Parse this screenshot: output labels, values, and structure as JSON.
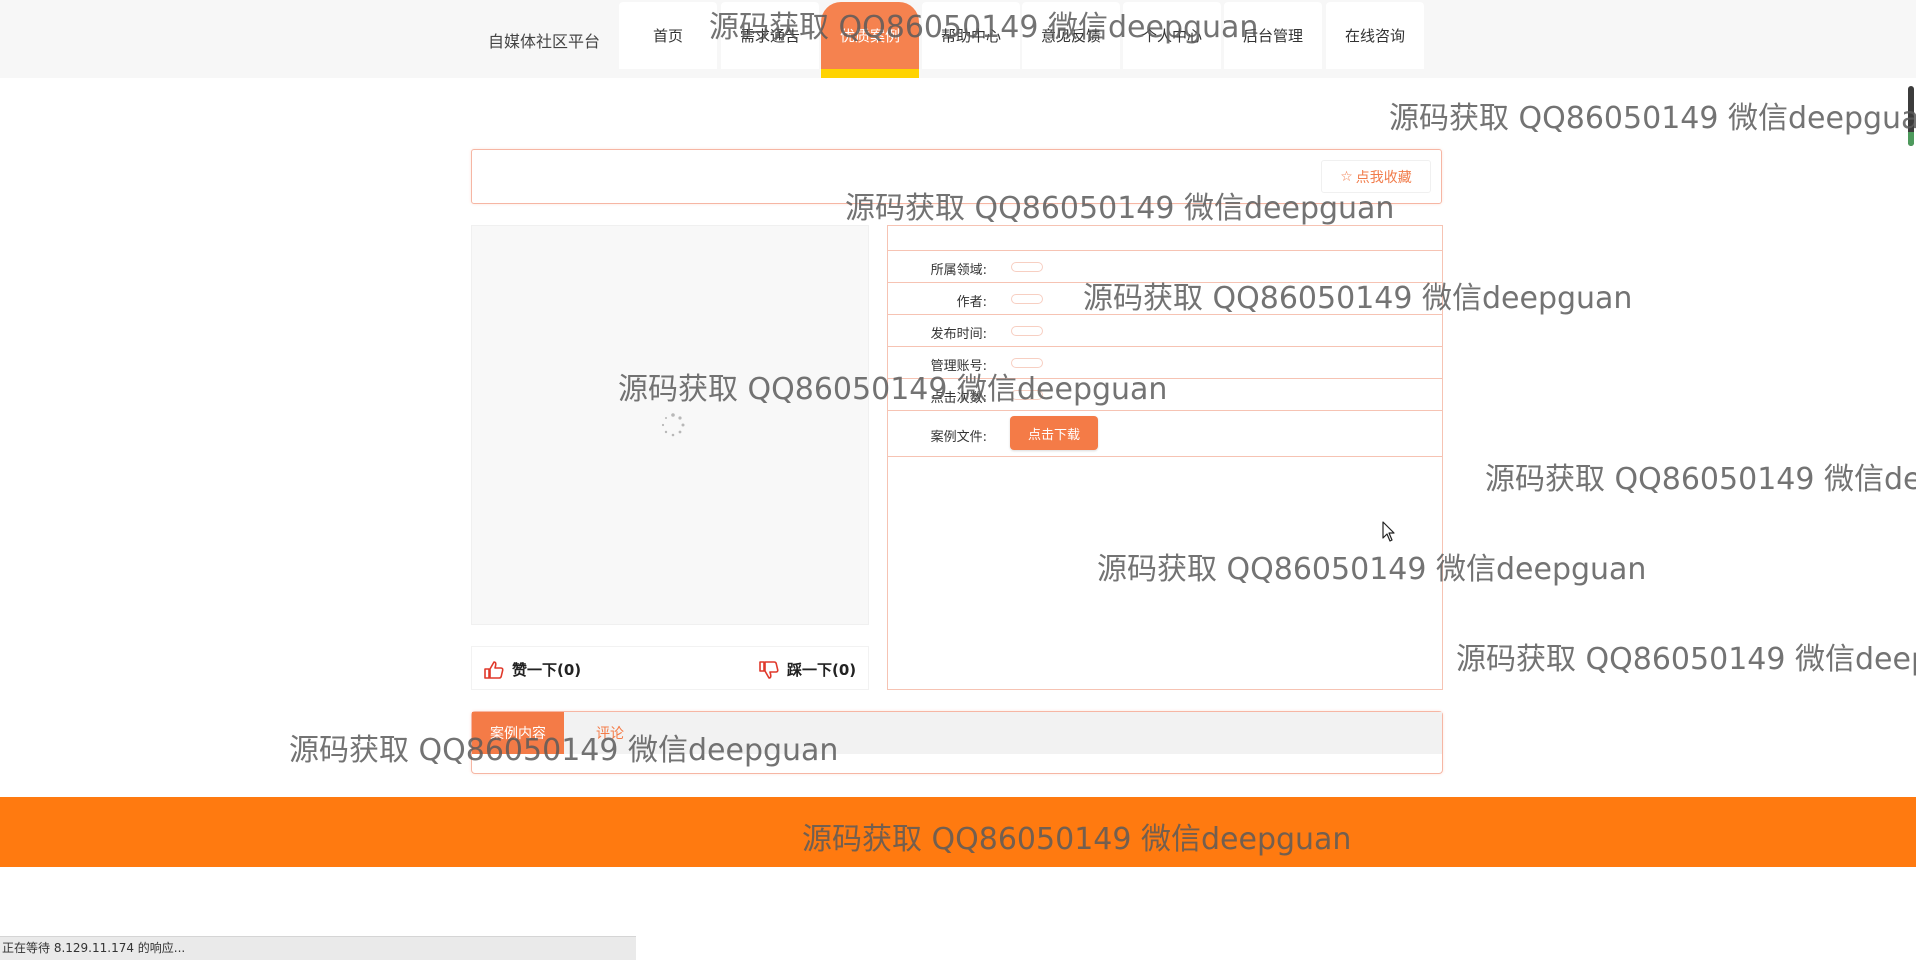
{
  "header": {
    "brand": "自媒体社区平台",
    "nav": [
      {
        "label": "首页",
        "active": false
      },
      {
        "label": "需求通告",
        "active": false
      },
      {
        "label": "优质案例",
        "active": true
      },
      {
        "label": "帮助中心",
        "active": false
      },
      {
        "label": "意见反馈",
        "active": false
      },
      {
        "label": "个人中心",
        "active": false
      },
      {
        "label": "后台管理",
        "active": false
      },
      {
        "label": "在线咨询",
        "active": false
      }
    ]
  },
  "detail": {
    "favorite_label": "点我收藏",
    "like_label": "赞一下(0)",
    "dislike_label": "踩一下(0)",
    "fields": [
      {
        "label": "所属领域:",
        "value": ""
      },
      {
        "label": "作者:",
        "value": ""
      },
      {
        "label": "发布时间:",
        "value": ""
      },
      {
        "label": "管理账号:",
        "value": ""
      },
      {
        "label": "点击次数:",
        "value": ""
      }
    ],
    "file_label": "案例文件:",
    "download_label": "点击下载"
  },
  "tabs": [
    "案例内容",
    "评论"
  ],
  "status_text": "正在等待 8.129.11.174 的响应...",
  "watermark_text": "源码获取 QQ86050149 微信deepguan",
  "colors": {
    "accent": "#f47b47",
    "footer": "#ff7a10",
    "highlight": "#ffd300",
    "border": "#f6b6a4"
  }
}
